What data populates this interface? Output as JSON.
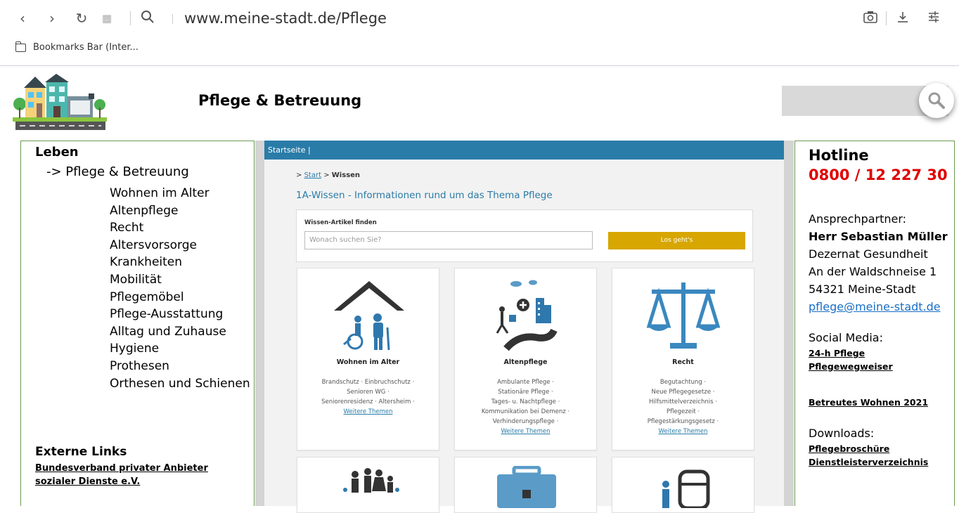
{
  "browser": {
    "url": "www.meine-stadt.de/Pflege",
    "bookmarks_label": "Bookmarks Bar (Inter..."
  },
  "header": {
    "title": "Pflege & Betreuung"
  },
  "left": {
    "heading": "Leben",
    "current": "-> Pflege & Betreuung",
    "items": [
      "Wohnen im Alter",
      "Altenpflege",
      "Recht",
      "Altersvorsorge",
      "Krankheiten",
      "Mobilität",
      "Pflegemöbel",
      "Pflege-Ausstattung",
      "Alltag und Zuhause",
      "Hygiene",
      "Prothesen",
      "Orthesen und Schienen"
    ],
    "external_heading": "Externe Links",
    "external_link_line1": "Bundesverband privater Anbieter",
    "external_link_line2": "sozialer Dienste e.V."
  },
  "center": {
    "bluebar": "Startseite  |",
    "crumb_prefix": ">",
    "crumb_start": "Start",
    "crumb_sep": ">",
    "crumb_current": "Wissen",
    "heading": "1A-Wissen - Informationen rund um das Thema Pflege",
    "finder_label": "Wissen-Artikel finden",
    "finder_placeholder": "Wonach suchen Sie?",
    "finder_button": "Los geht's",
    "cards": [
      {
        "title": "Wohnen im Alter",
        "lines": [
          "Brandschutz · Einbruchschutz ·",
          "Senioren WG ·",
          "Seniorenresidenz · Altersheim ·"
        ],
        "more": "Weitere Themen"
      },
      {
        "title": "Altenpflege",
        "lines": [
          "Ambulante Pflege ·",
          "Stationäre Pflege ·",
          "Tages- u. Nachtpflege ·",
          "Kommunikation bei Demenz ·",
          "Verhinderungspflege ·"
        ],
        "more": "Weitere Themen"
      },
      {
        "title": "Recht",
        "lines": [
          "Begutachtung ·",
          "Neue Pflegegesetze ·",
          "Hilfsmittelverzeichnis ·",
          "Pflegezeit ·",
          "Pflegestärkungsgesetz ·"
        ],
        "more": "Weitere Themen"
      }
    ]
  },
  "right": {
    "hotline_label": "Hotline",
    "hotline_number": "0800 / 12 227 30",
    "contact_label": "Ansprechpartner:",
    "contact_name": "Herr Sebastian Müller",
    "dept": "Dezernat Gesundheit",
    "street": "An der Waldschneise 1",
    "city": "54321 Meine-Stadt",
    "email": "pflege@meine-stadt.de",
    "social_label": "Social Media:",
    "social_1": "24-h Pflege",
    "social_2": "Pflegewegweiser",
    "promo": "Betreutes Wohnen 2021",
    "downloads_label": "Downloads:",
    "download_1": "Pflegebroschüre",
    "download_2": "Dienstleisterverzeichnis"
  },
  "colors": {
    "accent_blue": "#2a7ca8",
    "button_gold": "#d7a600",
    "hotline_red": "#e00000",
    "border_green": "#6b9a52"
  }
}
